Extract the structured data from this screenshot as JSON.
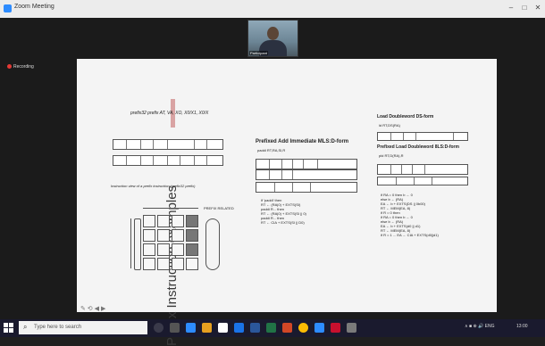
{
  "window": {
    "title": "Zoom Meeting",
    "minimize": "–",
    "maximize": "□",
    "close": "✕"
  },
  "recording": {
    "label": "Recording"
  },
  "selfview": {
    "caption": "Participant"
  },
  "slide": {
    "vertical_title": "Prefix Instruction examples",
    "heading_left": "prefix32 prefix AT, VA, XO, X0/X1, X0/X",
    "caption_left": "Instruction view of a prefix instruction (prefix32 prefix)",
    "prefixed_add": "Prefixed Add Immediate MLS:D-form",
    "prefixed_add_op": "paddi RT,RA,SI,R",
    "load_dw": "Load Doubleword DS-form",
    "load_dw_op": "ld RT,DS(RA)",
    "prefixed_load": "Prefixed Load Doubleword 8LS:D-form",
    "prefixed_load_op": "pld RT,D(RA),R",
    "code_mid": [
      "if 'paddi' then",
      "  RT ← (RA|0) + EXTS(SI)",
      "  paddi R... then",
      "  RT ← (RA|0) + EXTS(SI || 0)",
      "  paddi R... then",
      "  RT ← CIA + EXTS(SI || D0)"
    ],
    "code_right": [
      "if RA = 0 then b ← 0",
      "  else b ← (RA)",
      "  EA ← b + EXTS(DS || 0b00)",
      "  RT ← MEM(EA, 8)",
      "if R = 0 then",
      "  if RA = 0 then b ← 0",
      "  else b ← (RA)",
      "  EA ← b + EXTS(d0 || d1)",
      "  RT ← MEM(EA, 8)",
      "  if R = 1 ... EA ← CIA + EXTS(d0||d1)"
    ],
    "grid_label": "PREFIX RELATED"
  },
  "taskbar": {
    "search_placeholder": "Type here to search",
    "tray_text": "∧ ■ ⊕ 🔊 ENG",
    "clock": "13:00"
  },
  "colors": {
    "accent": "#2d8cff",
    "record": "#e53935"
  }
}
